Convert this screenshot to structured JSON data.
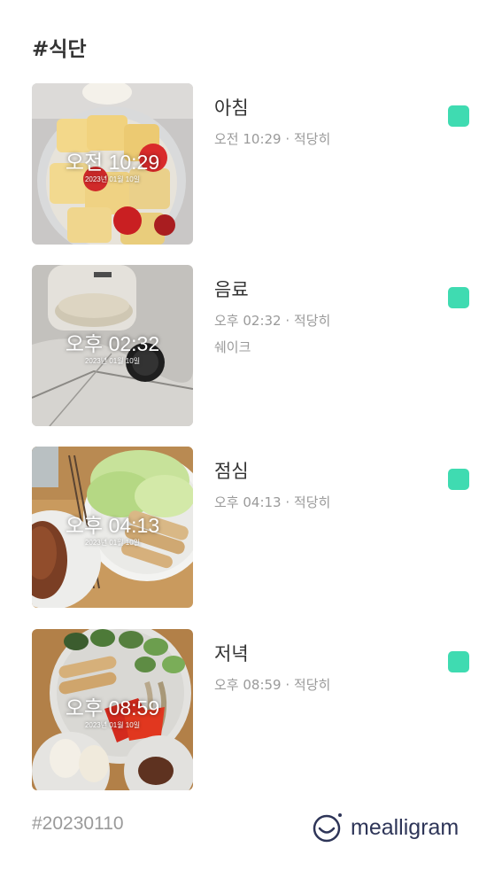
{
  "title": "#식단",
  "meals": [
    {
      "name": "아침",
      "meta": "오전 10:29 · 적당히",
      "note": "",
      "overlay_time": "오전 10:29",
      "overlay_date": "2023년 01월 10일",
      "photo_icon": "fruit-bowl-photo"
    },
    {
      "name": "음료",
      "meta": "오후 02:32 · 적당히",
      "note": "쉐이크",
      "overlay_time": "오후 02:32",
      "overlay_date": "2023년 01월 10일",
      "photo_icon": "shake-drink-photo"
    },
    {
      "name": "점심",
      "meta": "오후 04:13 · 적당히",
      "note": "",
      "overlay_time": "오후 04:13",
      "overlay_date": "2023년 01월 10일",
      "photo_icon": "salad-chicken-photo"
    },
    {
      "name": "저녁",
      "meta": "오후 08:59 · 적당히",
      "note": "",
      "overlay_time": "오후 08:59",
      "overlay_date": "2023년 01월 10일",
      "photo_icon": "dinner-plate-photo"
    }
  ],
  "status_color": "#3fdbb1",
  "footer": {
    "tag": "#20230110",
    "brand": "mealligram"
  }
}
